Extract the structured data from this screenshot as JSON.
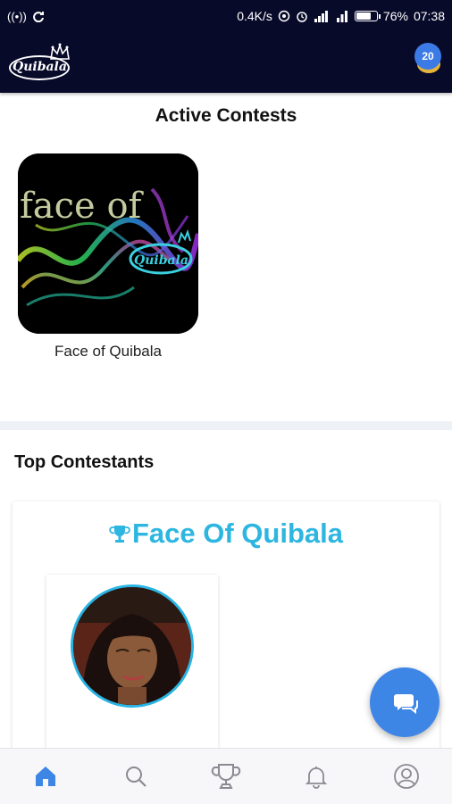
{
  "status_bar": {
    "network_speed": "0.4K/s",
    "battery_percent": "76%",
    "battery_level": 0.76,
    "time": "07:38",
    "icons": [
      "hotspot-icon",
      "sync-icon",
      "nfc-icon",
      "alarm-icon",
      "signal-icon",
      "wifi-icon",
      "battery-icon"
    ]
  },
  "app_bar": {
    "logo_text": "Quibala",
    "coin_count": "20"
  },
  "active_contests": {
    "title": "Active Contests",
    "items": [
      {
        "name": "Face of Quibala",
        "image_text": "face of",
        "image_logo_text": "Quibala"
      }
    ]
  },
  "top_contestants": {
    "title": "Top Contestants",
    "card_title": "Face Of Quibala"
  },
  "bottom_nav": {
    "items": [
      {
        "icon": "home-icon",
        "active": true
      },
      {
        "icon": "search-icon",
        "active": false
      },
      {
        "icon": "trophy-icon",
        "active": false
      },
      {
        "icon": "bell-icon",
        "active": false
      },
      {
        "icon": "profile-icon",
        "active": false
      }
    ]
  },
  "colors": {
    "header_bg": "#080a2a",
    "accent_blue": "#3e86e6",
    "title_cyan": "#2cb6e0",
    "coin_gold": "#e6b43a"
  }
}
